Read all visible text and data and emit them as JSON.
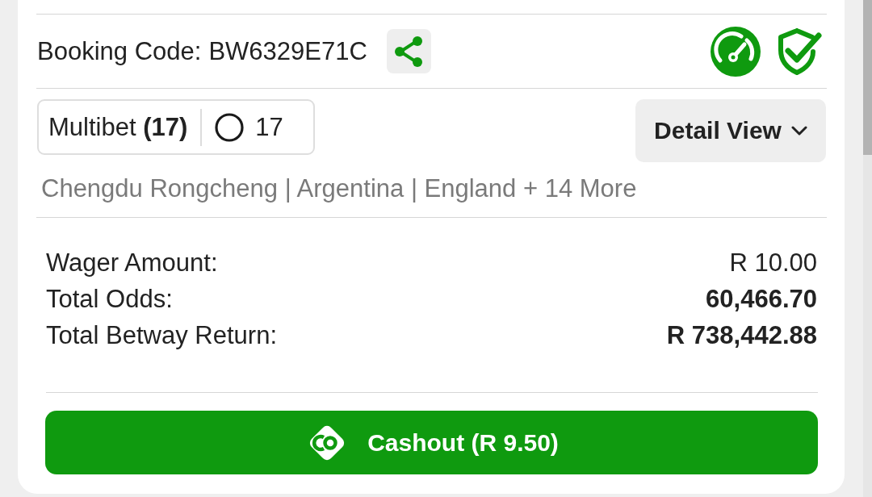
{
  "booking": {
    "label": "Booking Code:",
    "code": "BW6329E71C"
  },
  "bet": {
    "type_label": "Multibet **(17)**",
    "legs": "17"
  },
  "detail_view": {
    "label": "Detail View"
  },
  "selections_summary": "Chengdu Rongcheng | Argentina | England + 14 More",
  "summary": [
    {
      "label": "Wager Amount:",
      "value": "R 10.00",
      "emphasis": false
    },
    {
      "label": "Total Odds:",
      "value": "60,466.70",
      "emphasis": true
    },
    {
      "label": "Total Betway Return:",
      "value": "R 738,442.88",
      "emphasis": true
    }
  ],
  "cashout": {
    "label": "Cashout (R 9.50)"
  }
}
